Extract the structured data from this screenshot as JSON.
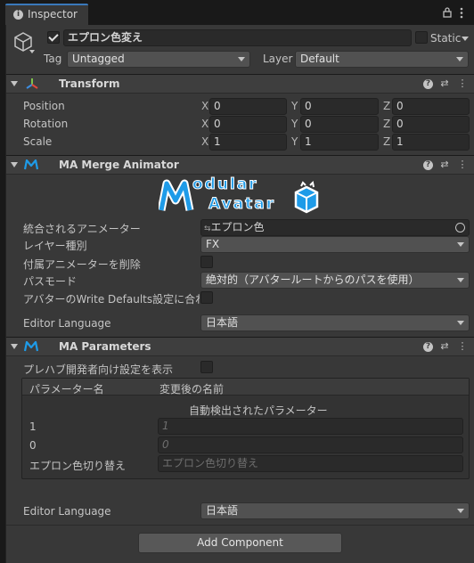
{
  "tab": {
    "title": "Inspector"
  },
  "object": {
    "name": "エプロン色変え",
    "active": true,
    "static_label": "Static",
    "tag_label": "Tag",
    "tag_value": "Untagged",
    "layer_label": "Layer",
    "layer_value": "Default"
  },
  "transform": {
    "title": "Transform",
    "position": {
      "label": "Position",
      "x": "0",
      "y": "0",
      "z": "0"
    },
    "rotation": {
      "label": "Rotation",
      "x": "0",
      "y": "0",
      "z": "0"
    },
    "scale": {
      "label": "Scale",
      "x": "1",
      "y": "1",
      "z": "1"
    },
    "axis_x": "X",
    "axis_y": "Y",
    "axis_z": "Z"
  },
  "merge_animator": {
    "title": "MA Merge Animator",
    "logo_text_1": "odular",
    "logo_text_2": "Avatar",
    "animator_label": "統合されるアニメーター",
    "animator_value": "エプロン色",
    "layer_type_label": "レイヤー種別",
    "layer_type_value": "FX",
    "delete_attached_label": "付属アニメーターを削除",
    "delete_attached_checked": false,
    "path_mode_label": "パスモード",
    "path_mode_value": "絶対的（アバタールートからのパスを使用）",
    "write_defaults_label": "アバターのWrite Defaults設定に合わせる",
    "write_defaults_checked": false,
    "editor_language_label": "Editor Language",
    "editor_language_value": "日本語"
  },
  "parameters": {
    "title": "MA Parameters",
    "show_prefab_label": "プレハブ開発者向け設定を表示",
    "show_prefab_checked": false,
    "col_param_name": "パラメーター名",
    "col_renamed": "変更後の名前",
    "auto_detected_label": "自動検出されたパラメーター",
    "rows": [
      {
        "name": "1",
        "placeholder": "1"
      },
      {
        "name": "0",
        "placeholder": "0"
      },
      {
        "name": "エプロン色切り替え",
        "placeholder": "エプロン色切り替え"
      }
    ],
    "editor_language_label": "Editor Language",
    "editor_language_value": "日本語"
  },
  "add_component_label": "Add Component",
  "colors": {
    "accent": "#3a79bb",
    "ma_blue": "#1e9be8"
  }
}
